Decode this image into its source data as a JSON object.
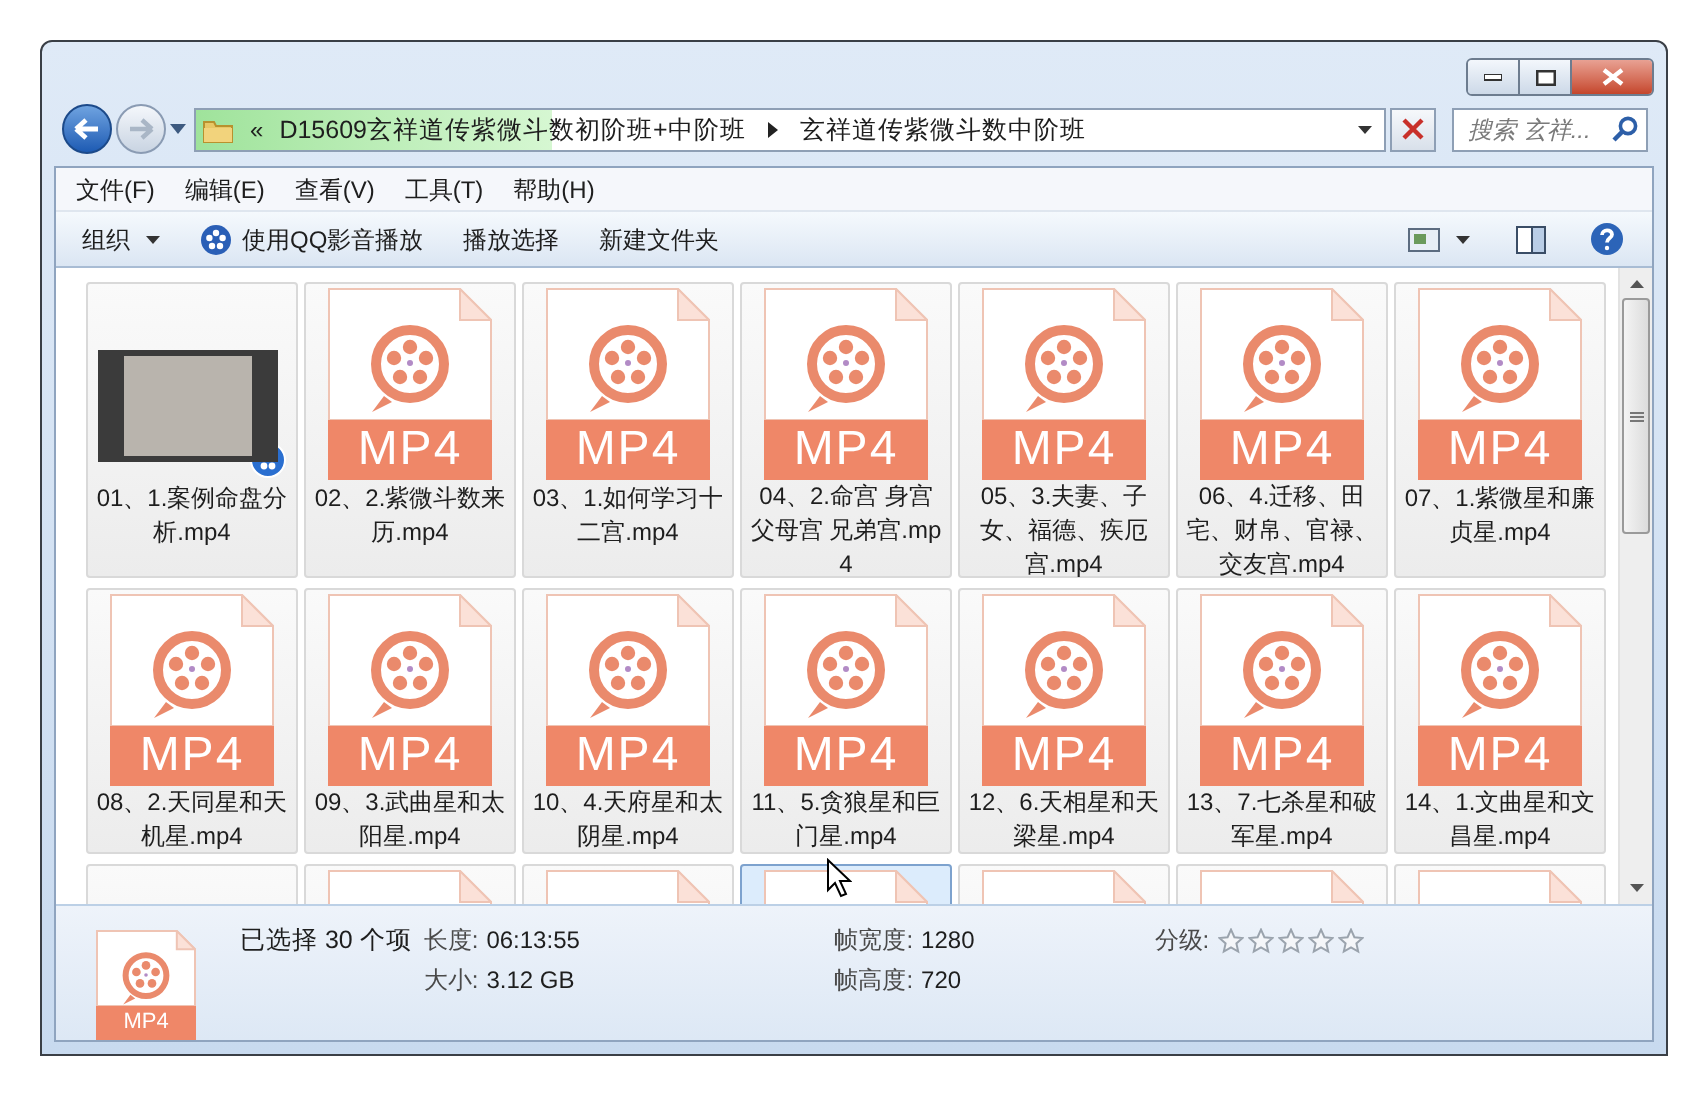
{
  "address_bar": {
    "overflow": "«",
    "path": [
      "D15609玄祥道传紫微斗数初阶班+中阶班",
      "玄祥道传紫微斗数中阶班"
    ],
    "level": 0.3
  },
  "search": {
    "placeholder": "搜索 玄祥..."
  },
  "menu": [
    "文件(F)",
    "编辑(E)",
    "查看(V)",
    "工具(T)",
    "帮助(H)"
  ],
  "toolbar": [
    {
      "label": "组织",
      "kind": "dropdown"
    },
    {
      "label": "使用QQ影音播放",
      "kind": "app"
    },
    {
      "label": "播放选择",
      "kind": "plain"
    },
    {
      "label": "新建文件夹",
      "kind": "plain"
    }
  ],
  "files": [
    {
      "name": "01、1.案例命盘分析.mp4",
      "kind": "thumbnail",
      "selected": true,
      "hot": false
    },
    {
      "name": "02、2.紫微斗数来历.mp4",
      "kind": "mp4",
      "badge": "MP4",
      "selected": true,
      "hot": false
    },
    {
      "name": "03、1.如何学习十二宫.mp4",
      "kind": "mp4",
      "badge": "MP4",
      "selected": true,
      "hot": false
    },
    {
      "name": "04、2.命宫 身宫父母宫 兄弟宫.mp4",
      "kind": "mp4",
      "badge": "MP4",
      "selected": true,
      "hot": false
    },
    {
      "name": "05、3.夫妻、子女、福德、疾厄宫.mp4",
      "kind": "mp4",
      "badge": "MP4",
      "selected": true,
      "hot": false
    },
    {
      "name": "06、4.迁移、田宅、财帛、官禄、交友宫.mp4",
      "kind": "mp4",
      "badge": "MP4",
      "selected": true,
      "hot": false
    },
    {
      "name": "07、1.紫微星和廉贞星.mp4",
      "kind": "mp4",
      "badge": "MP4",
      "selected": true,
      "hot": false
    },
    {
      "name": "08、2.天同星和天机星.mp4",
      "kind": "mp4",
      "badge": "MP4",
      "selected": true,
      "hot": false
    },
    {
      "name": "09、3.武曲星和太阳星.mp4",
      "kind": "mp4",
      "badge": "MP4",
      "selected": true,
      "hot": false
    },
    {
      "name": "10、4.天府星和太阴星.mp4",
      "kind": "mp4",
      "badge": "MP4",
      "selected": true,
      "hot": false
    },
    {
      "name": "11、5.贪狼星和巨门星.mp4",
      "kind": "mp4",
      "badge": "MP4",
      "selected": true,
      "hot": false
    },
    {
      "name": "12、6.天相星和天梁星.mp4",
      "kind": "mp4",
      "badge": "MP4",
      "selected": true,
      "hot": false
    },
    {
      "name": "13、7.七杀星和破军星.mp4",
      "kind": "mp4",
      "badge": "MP4",
      "selected": true,
      "hot": false
    },
    {
      "name": "14、1.文曲星和文昌星.mp4",
      "kind": "mp4",
      "badge": "MP4",
      "selected": true,
      "hot": false
    },
    {
      "kind": "blank",
      "selected": true,
      "hot": false
    },
    {
      "kind": "mp4",
      "selected": true,
      "hot": false
    },
    {
      "kind": "mp4",
      "selected": true,
      "hot": false
    },
    {
      "kind": "mp4",
      "selected": true,
      "hot": true
    },
    {
      "kind": "mp4",
      "selected": true,
      "hot": false
    },
    {
      "kind": "mp4",
      "selected": true,
      "hot": false
    },
    {
      "kind": "mp4",
      "selected": true,
      "hot": false
    }
  ],
  "details": {
    "icon_badge": "MP4",
    "summary": "已选择 30 个项",
    "fields": [
      {
        "label": "长度:",
        "value": "06:13:55"
      },
      {
        "label": "帧宽度:",
        "value": "1280"
      },
      {
        "label": "大小:",
        "value": "3.12 GB"
      },
      {
        "label": "帧高度:",
        "value": "720"
      }
    ],
    "rating": {
      "label": "分级:",
      "stars": 0
    }
  }
}
